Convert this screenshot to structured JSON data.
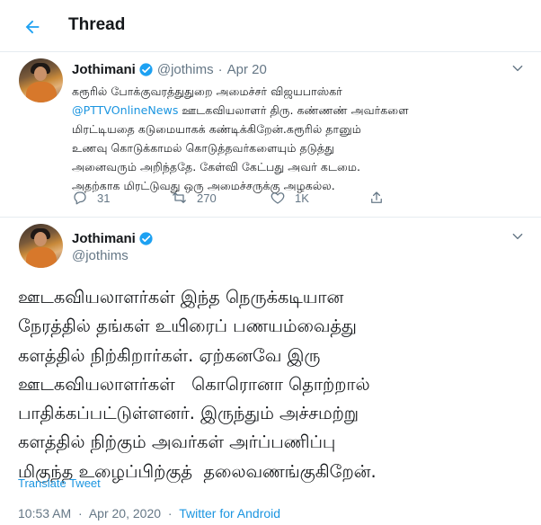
{
  "header": {
    "back_icon": "arrow-left-icon",
    "title": "Thread",
    "accent_color": "#1da1f2"
  },
  "tweet1": {
    "name": "Jothimani",
    "handle": "@jothims",
    "date": "Apr 20",
    "verified_icon": "verified-badge-icon",
    "text_lines": [
      "கரூரில் போக்குவரத்துதுறை அமைச்சர் விஜயபாஸ்கர்",
      "ஊடகவியலாளர் திரு. கண்ணண் அவர்களை",
      "மிரட்டியதை கடுமையாகக் கண்டிக்கிறேன்.கரூரில் தானும்",
      "உணவு கொடுக்காமல் கொடுத்தவர்களையும் தடுத்து",
      "அனைவரும் அறிந்ததே. கேள்வி கேட்பது அவர் கடமை.",
      "அதற்காக மிரட்டுவது ஒரு அமைச்சருக்கு அழகல்ல."
    ],
    "mention": "@PTTVOnlineNews",
    "actions": {
      "reply_count": "31",
      "retweet_count": "270",
      "like_count": "1K"
    }
  },
  "tweet2": {
    "name": "Jothimani",
    "handle": "@jothims",
    "text_lines": [
      "ஊடகவியலாளர்கள் இந்த நெருக்கடியான",
      "நேரத்தில் தங்கள் உயிரைப் பணயம்வைத்து",
      "களத்தில் நிற்கிறார்கள். ஏற்கனவே இரு",
      "ஊடகவியலாளர்கள்   கொரொனா தொற்றால்",
      "பாதிக்கப்பட்டுள்ளனர். இருந்தும் அச்சமற்று",
      "களத்தில் நிற்கும் அவர்கள் அர்ப்பணிப்பு",
      "மிகுந்த உழைப்பிற்குத்  தலைவணங்குகிறேன்."
    ],
    "translate_label": "Translate Tweet",
    "time": "10:53 AM",
    "separator": "·",
    "full_date": "Apr 20, 2020",
    "source": "Twitter for Android"
  }
}
